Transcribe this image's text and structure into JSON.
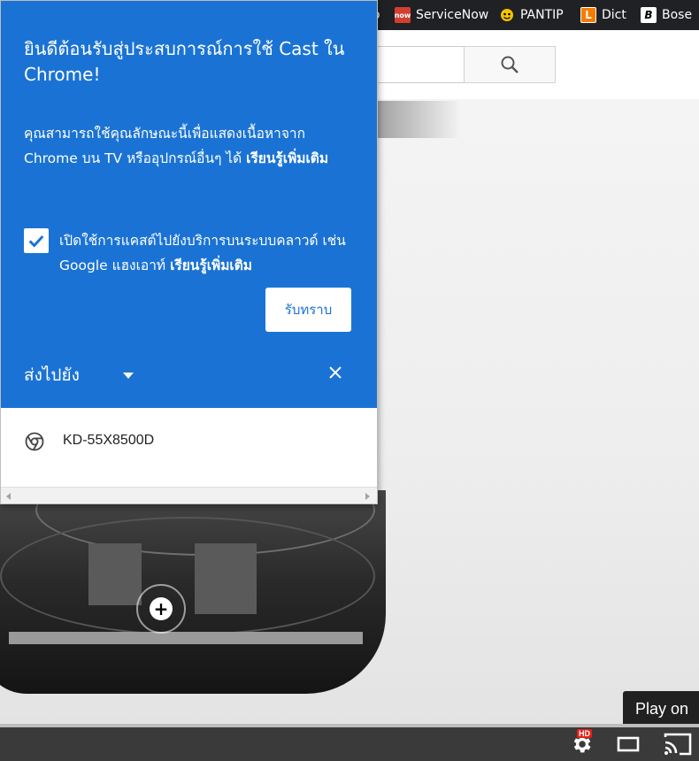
{
  "bookmarks": {
    "cutoff_label": "o",
    "items": [
      {
        "label": "ServiceNow",
        "icon": "servicenow-icon",
        "icon_text": "now",
        "color": "#d23f31"
      },
      {
        "label": "PANTIP",
        "icon": "pantip-icon",
        "color": "#f5c400"
      },
      {
        "label": "Dict",
        "icon": "dict-icon",
        "icon_text": "L",
        "color": "#f57c00"
      },
      {
        "label": "Bose",
        "icon": "bose-icon",
        "icon_text": "B",
        "color": "#ffffff"
      }
    ]
  },
  "page": {
    "search_icon": "search-icon",
    "play_on_label": "Play on",
    "add_icon": "plus-icon"
  },
  "controls": {
    "settings_icon": "gear-icon",
    "hd_badge": "HD",
    "theater_icon": "theater-mode-icon",
    "cast_icon": "cast-icon"
  },
  "cast_dialog": {
    "title": "ยินดีต้อนรับสู่ประสบการณ์การใช้ Cast ใน Chrome!",
    "description": "คุณสามารถใช้คุณลักษณะนี้เพื่อแสดงเนื้อหาจาก Chrome บน TV หรืออุปกรณ์อื่นๆ ได้",
    "learn_more": "เรียนรู้เพิ่มเติม",
    "cloud_checkbox_checked": true,
    "cloud_label": "เปิดใช้การแคสต์ไปยังบริการบนระบบคลาวด์ เช่น Google แฮงเอาท์",
    "cloud_learn_more": "เรียนรู้เพิ่มเติม",
    "ok_button": "รับทราบ",
    "cast_to_label": "ส่งไปยัง",
    "close_icon": "close-icon",
    "devices": [
      {
        "name": "KD-55X8500D",
        "icon": "chrome-icon"
      }
    ],
    "accent_color": "#1a73d4"
  }
}
